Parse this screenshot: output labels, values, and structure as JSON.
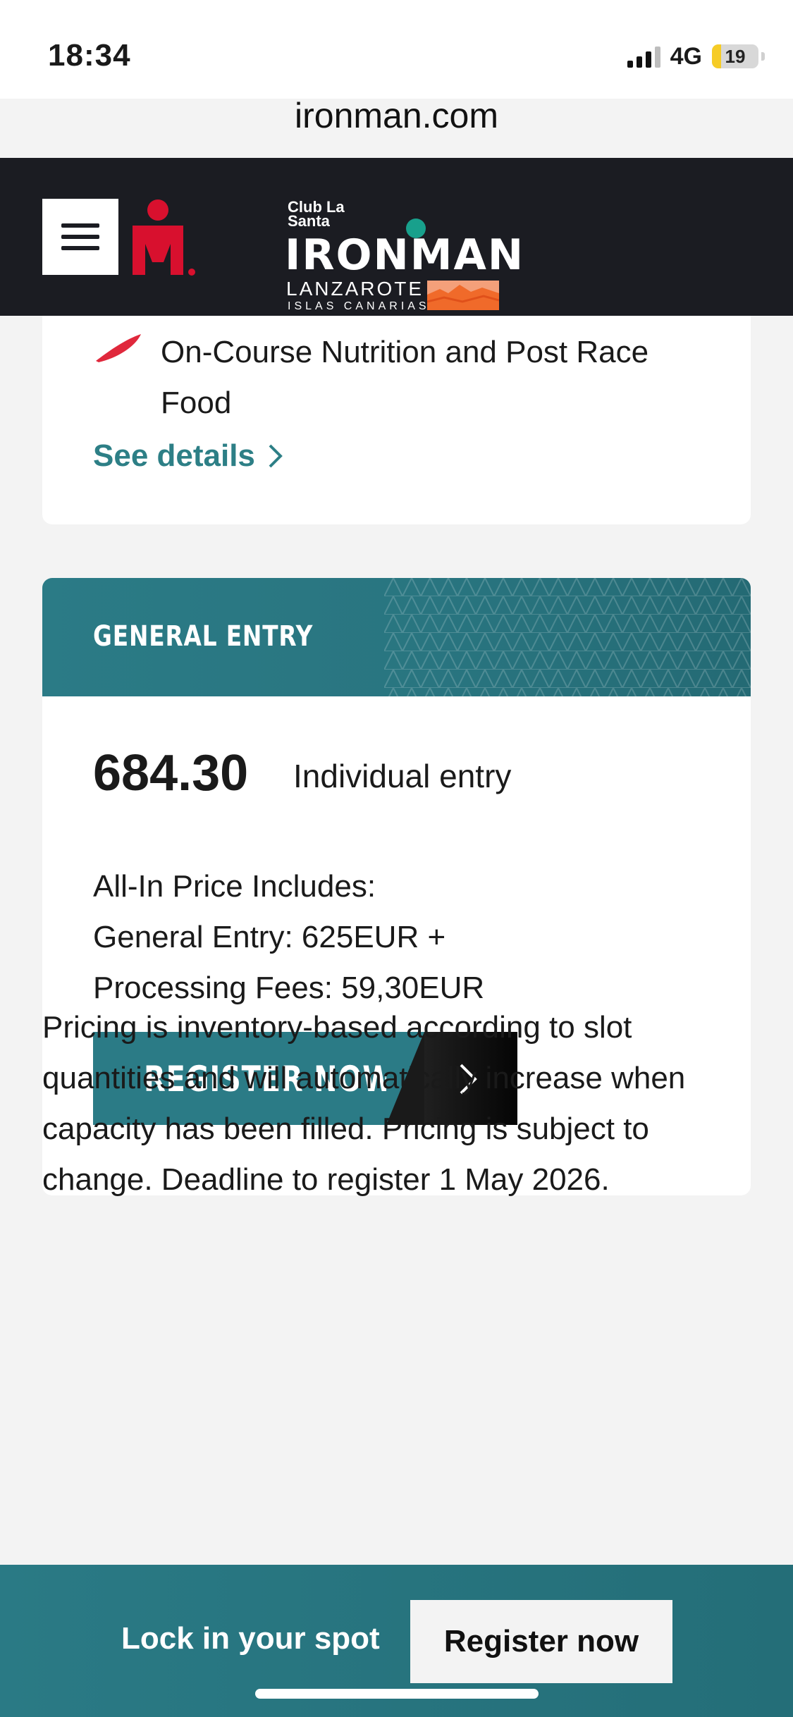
{
  "status_bar": {
    "time": "18:34",
    "network": "4G",
    "battery_percent": "19",
    "battery_level": 0.19
  },
  "browser": {
    "url": "ironman.com"
  },
  "header": {
    "brand_club": "Club La Santa",
    "brand_name": "IRONMAN",
    "brand_location": "LANZAROTE",
    "brand_sublocation": "ISLAS CANARIAS",
    "icons": [
      "menu-icon",
      "mdot-logo",
      "search-icon",
      "account-icon"
    ]
  },
  "feature_card": {
    "feature_text": "On-Course Nutrition and Post Race Food",
    "see_details": "See details"
  },
  "entry_card": {
    "title": "GENERAL ENTRY",
    "price": "684.30",
    "price_label": "Individual entry",
    "includes_heading": "All-In Price Includes:",
    "includes_line1": "General Entry: 625EUR +",
    "includes_line2": "Processing Fees: 59,30EUR",
    "register_label": "REGISTER NOW"
  },
  "pricing_note": "Pricing is inventory-based according to slot quantities and will automatically increase when capacity has been filled. Pricing is subject to change. Deadline to register 1 May 2026.",
  "bottom_cta": {
    "text": "Lock in your spot",
    "button": "Register now"
  },
  "colors": {
    "accent": "#2b7b86",
    "header_bg": "#1b1c22",
    "brand_red": "#d8102e",
    "brand_green": "#18a08c",
    "battery": "#f6cc26"
  }
}
